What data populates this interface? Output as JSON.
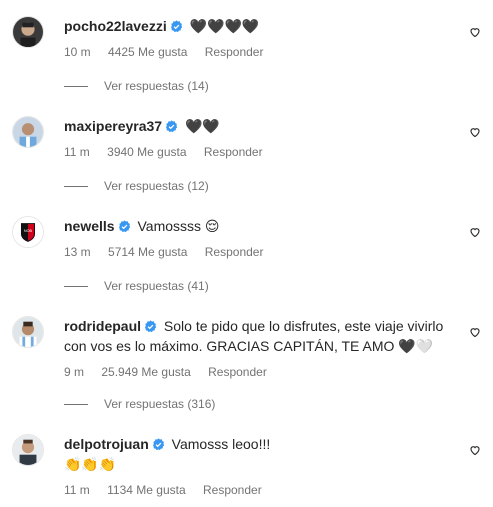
{
  "comments": [
    {
      "username": "pocho22lavezzi",
      "verified": true,
      "text": "🖤🖤🖤🖤",
      "time": "10 m",
      "likes": "4425 Me gusta",
      "reply_label": "Responder",
      "view_replies": "Ver respuestas (14)"
    },
    {
      "username": "maxipereyra37",
      "verified": true,
      "text": "🖤🖤",
      "time": "11 m",
      "likes": "3940 Me gusta",
      "reply_label": "Responder",
      "view_replies": "Ver respuestas (12)"
    },
    {
      "username": "newells",
      "verified": true,
      "text": "Vamossss 😌",
      "time": "13 m",
      "likes": "5714 Me gusta",
      "reply_label": "Responder",
      "view_replies": "Ver respuestas (41)"
    },
    {
      "username": "rodridepaul",
      "verified": true,
      "text": "Solo te pido que lo disfrutes, este viaje vivirlo con vos es lo máximo. GRACIAS CAPITÁN, TE AMO 🖤🤍",
      "time": "9 m",
      "likes": "25.949 Me gusta",
      "reply_label": "Responder",
      "view_replies": "Ver respuestas (316)"
    },
    {
      "username": "delpotrojuan",
      "verified": true,
      "text": "Vamosss leoo!!!",
      "text2": "👏👏👏",
      "time": "11 m",
      "likes": "1134 Me gusta",
      "reply_label": "Responder"
    }
  ],
  "colors": {
    "verified": "#3897f0",
    "meta": "#737373",
    "text": "#262626"
  },
  "icons": {
    "like": "heart-outline-icon",
    "verified": "verified-badge-icon"
  }
}
